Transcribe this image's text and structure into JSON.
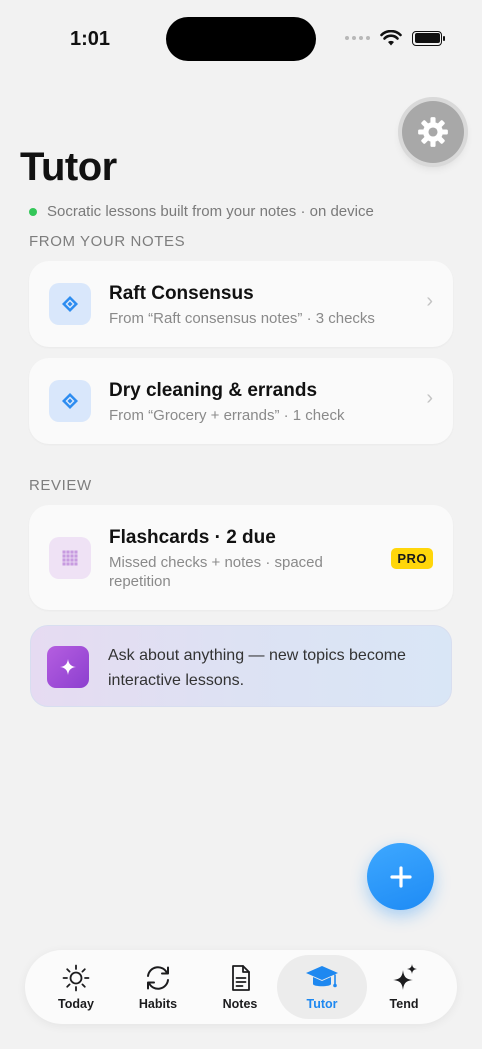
{
  "status": {
    "time": "1:01"
  },
  "header": {
    "title": "Tutor",
    "subtitle": "Socratic lessons built from your notes · on device"
  },
  "sections": {
    "from_notes": "FROM YOUR NOTES",
    "review": "REVIEW"
  },
  "lessons": [
    {
      "title": "Raft Consensus",
      "subtitle": "From “Raft consensus notes” · 3 checks"
    },
    {
      "title": "Dry cleaning & errands",
      "subtitle": "From “Grocery + errands” · 1 check"
    }
  ],
  "flashcards": {
    "title": "Flashcards · 2 due",
    "subtitle": "Missed checks + notes · spaced repetition",
    "badge": "PRO"
  },
  "ask": {
    "text": "Ask about anything — new topics become interactive lessons."
  },
  "tabs": [
    {
      "label": "Today",
      "icon": "sun-icon"
    },
    {
      "label": "Habits",
      "icon": "refresh-icon"
    },
    {
      "label": "Notes",
      "icon": "document-icon"
    },
    {
      "label": "Tutor",
      "icon": "graduation-cap-icon",
      "active": true
    },
    {
      "label": "Tend",
      "icon": "sparkles-icon"
    }
  ],
  "colors": {
    "accent": "#1e88f0",
    "status_dot": "#34c759",
    "pro_badge": "#ffd60a",
    "fab": "#2196f3"
  }
}
